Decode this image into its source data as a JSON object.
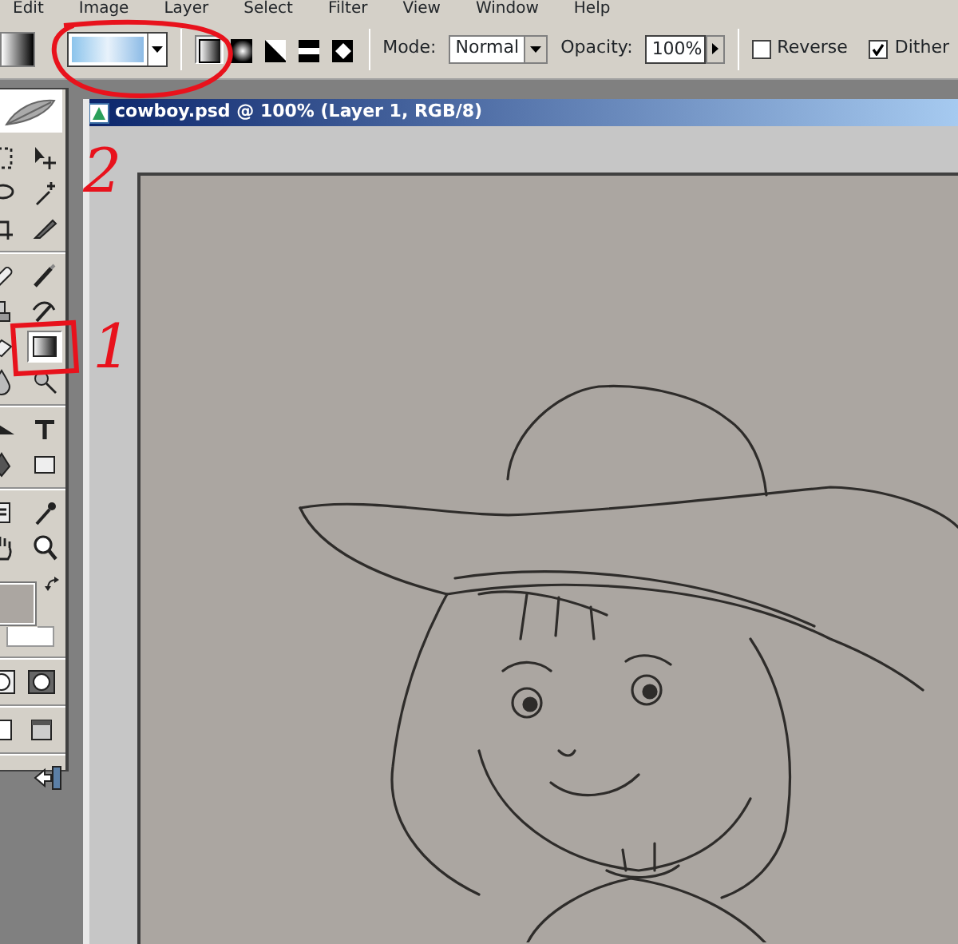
{
  "menu": [
    {
      "label": "Edit"
    },
    {
      "label": "Image"
    },
    {
      "label": "Layer"
    },
    {
      "label": "Select"
    },
    {
      "label": "Filter"
    },
    {
      "label": "View"
    },
    {
      "label": "Window"
    },
    {
      "label": "Help"
    }
  ],
  "options_bar": {
    "gradient_types": [
      {
        "kind": "linear",
        "selected": true
      },
      {
        "kind": "radial",
        "selected": false
      },
      {
        "kind": "angle",
        "selected": false
      },
      {
        "kind": "reflected",
        "selected": false
      },
      {
        "kind": "diamond",
        "selected": false
      }
    ],
    "mode": {
      "label": "Mode:",
      "value": "Normal"
    },
    "opacity": {
      "label": "Opacity:",
      "value": "100%"
    },
    "options": [
      {
        "label": "Reverse",
        "checked": false
      },
      {
        "label": "Dither",
        "checked": true
      }
    ]
  },
  "tools": [
    {
      "kind": "marquee",
      "selected": false
    },
    {
      "kind": "move",
      "selected": false
    },
    {
      "kind": "lasso",
      "selected": false
    },
    {
      "kind": "wand",
      "selected": false
    },
    {
      "kind": "crop",
      "selected": false
    },
    {
      "kind": "slice",
      "selected": false
    },
    {
      "kind": "healing",
      "selected": false
    },
    {
      "kind": "brush",
      "selected": false
    },
    {
      "kind": "stamp",
      "selected": false
    },
    {
      "kind": "history",
      "selected": false
    },
    {
      "kind": "eraser",
      "selected": false
    },
    {
      "kind": "gradient",
      "selected": true
    },
    {
      "kind": "blur",
      "selected": false
    },
    {
      "kind": "dodge",
      "selected": false
    },
    {
      "kind": "path",
      "selected": false
    },
    {
      "kind": "type",
      "selected": false
    },
    {
      "kind": "pen",
      "selected": false
    },
    {
      "kind": "shape",
      "selected": false
    },
    {
      "kind": "notes",
      "selected": false
    },
    {
      "kind": "eyedropper",
      "selected": false
    },
    {
      "kind": "hand",
      "selected": false
    },
    {
      "kind": "zoom",
      "selected": false
    }
  ],
  "document": {
    "title": "cowboy.psd @ 100% (Layer 1, RGB/8)"
  },
  "annotations": [
    {
      "text": "2"
    },
    {
      "text": "1"
    }
  ]
}
